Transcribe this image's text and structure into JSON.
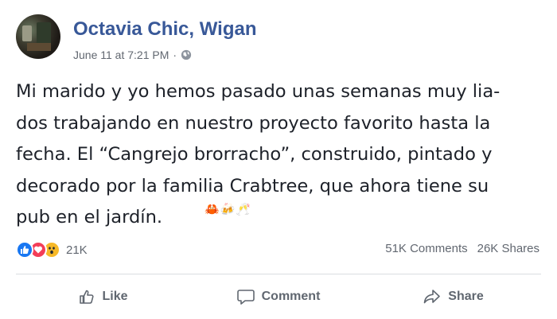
{
  "post": {
    "author": "Octavia Chic, Wigan",
    "timestamp": "June 11 at 7:21 PM",
    "separator": "·",
    "privacy_icon": "globe-icon",
    "text": "Mi marido y yo hemos pasado unas semanas muy lia-\ndos trabajando en nuestro proyecto favorito hasta la\nfecha. El “Cangrejo brorracho”, construido, pintado y\ndecorado por la familia Crabtree, que ahora tiene su\npub en el jardín.",
    "emojis": "🦀🍻🥂"
  },
  "reactions": {
    "types": [
      "like",
      "love",
      "wow"
    ],
    "count": "21K"
  },
  "stats": {
    "comments": "51K Comments",
    "shares": "26K Shares"
  },
  "actions": {
    "like": "Like",
    "comment": "Comment",
    "share": "Share"
  },
  "colors": {
    "brand": "#385898",
    "like": "#1877f2",
    "love": "#f33e58",
    "wow": "#f7b928",
    "muted": "#616770"
  }
}
